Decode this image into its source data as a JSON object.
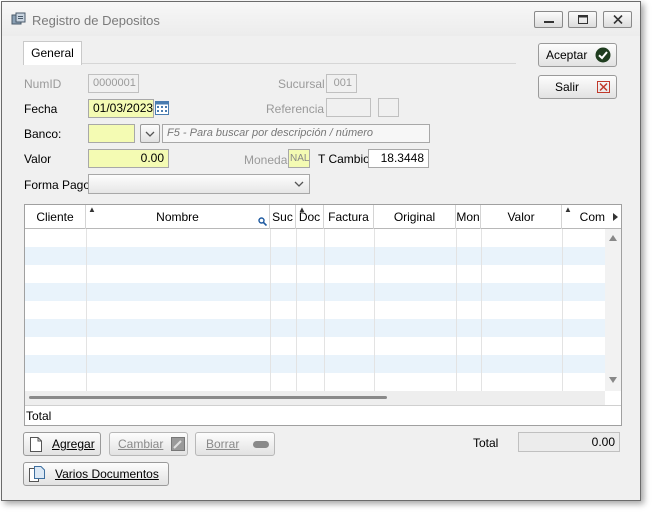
{
  "window": {
    "title": "Registro de Depositos"
  },
  "tabs": [
    {
      "label": "General"
    }
  ],
  "buttons": {
    "aceptar": "Aceptar",
    "salir": "Salir",
    "agregar": "Agregar",
    "cambiar": "Cambiar",
    "borrar": "Borrar",
    "varios": "Varios Documentos"
  },
  "form": {
    "numid": {
      "label": "NumID",
      "value": "0000001"
    },
    "sucursal": {
      "label": "Sucursal",
      "value": "001"
    },
    "fecha": {
      "label": "Fecha",
      "value": "01/03/2023"
    },
    "referencia": {
      "label": "Referencia",
      "value": "",
      "extra": ""
    },
    "banco": {
      "label": "Banco:",
      "value": "",
      "hint": "F5 - Para buscar por descripción / número"
    },
    "valor": {
      "label": "Valor",
      "value": "0.00"
    },
    "moneda": {
      "label": "Moneda",
      "value": "NAL"
    },
    "tcambio": {
      "label": "T Cambio",
      "value": "18.3448"
    },
    "formapago": {
      "label": "Forma Pago",
      "value": ""
    }
  },
  "grid": {
    "columns": [
      "Cliente",
      "Nombre",
      "Suc",
      "Doc",
      "Factura",
      "Original",
      "Mon",
      "Valor",
      "Com"
    ],
    "footer_label": "Total"
  },
  "summary": {
    "total_label": "Total",
    "total_value": "0.00"
  },
  "colors": {
    "accent_green": "#2f6b2f",
    "input_yellow": "#f4fbb3",
    "row_alt": "#e9f3fb",
    "close_red": "#c0392b"
  }
}
